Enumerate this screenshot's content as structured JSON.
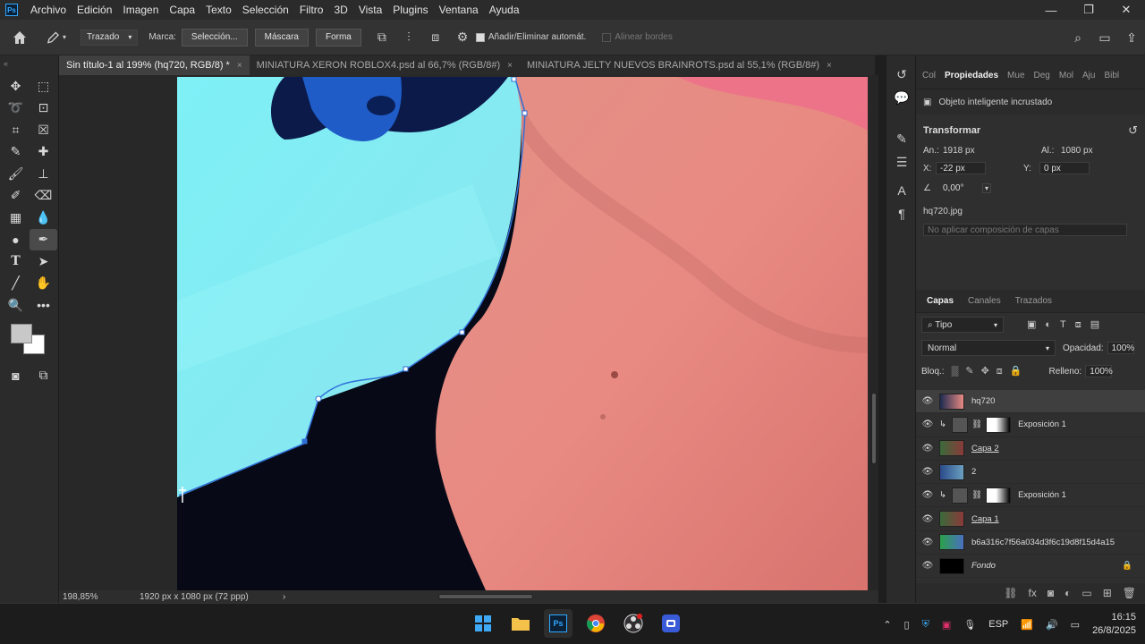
{
  "app": {
    "logo": "Ps",
    "menus": [
      "Archivo",
      "Edición",
      "Imagen",
      "Capa",
      "Texto",
      "Selección",
      "Filtro",
      "3D",
      "Vista",
      "Plugins",
      "Ventana",
      "Ayuda"
    ],
    "window_controls": [
      "—",
      "❐",
      "✕"
    ]
  },
  "options": {
    "mode": "Trazado",
    "mark_label": "Marca:",
    "seleccion": "Selección...",
    "mascara": "Máscara",
    "forma": "Forma",
    "auto_add": "Añadir/Eliminar automát.",
    "align_edges": "Alinear bordes"
  },
  "tabs": [
    {
      "label": "Sin título-1 al 199% (hq720, RGB/8) *",
      "close": "×"
    },
    {
      "label": "MINIATURA XERON ROBLOX4.psd al 66,7% (RGB/8#)",
      "close": "×"
    },
    {
      "label": "MINIATURA JELTY NUEVOS BRAINROTS.psd al 55,1% (RGB/8#)",
      "close": "×"
    }
  ],
  "status": {
    "zoom": "198,85%",
    "doc_size": "1920 px x 1080 px (72 ppp)",
    "arrow": "›"
  },
  "properties": {
    "tabs": [
      "Col",
      "Propiedades",
      "Mue",
      "Deg",
      "Mol",
      "Aju",
      "Bibl"
    ],
    "object_type": "Objeto inteligente incrustado",
    "transform_title": "Transformar",
    "an_label": "An.:",
    "an_value": "1918 px",
    "al_label": "Al.:",
    "al_value": "1080 px",
    "x_label": "X:",
    "x_value": "-22 px",
    "y_label": "Y:",
    "y_value": "0 px",
    "angle": "0,00°",
    "filename": "hq720.jpg",
    "comp_placeholder": "No aplicar composición de capas"
  },
  "layers_panel": {
    "tabs": [
      "Capas",
      "Canales",
      "Trazados"
    ],
    "filter": "Tipo",
    "blend_mode": "Normal",
    "opacity_label": "Opacidad:",
    "opacity": "100%",
    "lock_label": "Bloq.:",
    "fill_label": "Relleno:",
    "fill": "100%",
    "layers": [
      {
        "name": "hq720",
        "selected": true,
        "type": "smart"
      },
      {
        "name": "Exposición 1",
        "type": "adjustment"
      },
      {
        "name": "Capa 2",
        "type": "image"
      },
      {
        "name": "2",
        "type": "smart"
      },
      {
        "name": "Exposición 1",
        "type": "adjustment"
      },
      {
        "name": "Capa 1",
        "type": "image"
      },
      {
        "name": "b6a316c7f56a034d3f6c19d8f15d4a15",
        "type": "smart"
      },
      {
        "name": "Fondo",
        "type": "background"
      }
    ]
  },
  "taskbar": {
    "lang": "ESP",
    "time": "16:15",
    "date": "26/8/2025"
  },
  "colors": {
    "accent": "#31a8ff",
    "cyan_fill": "#84ecf3",
    "skin": "#e88a82"
  }
}
